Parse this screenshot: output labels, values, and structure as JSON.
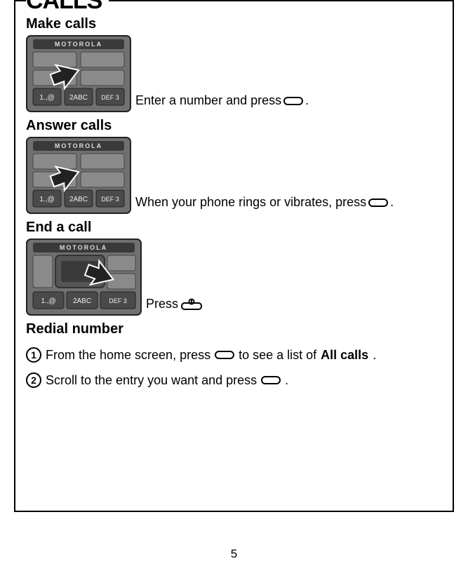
{
  "page_title": "CALLS",
  "sections": {
    "make": {
      "title": "Make calls",
      "text_a": "Enter a number and press",
      "text_b": "."
    },
    "answer": {
      "title": "Answer calls",
      "text_a": "When your phone rings or vibrates, press",
      "text_b": "."
    },
    "end": {
      "title": "End a call",
      "text_a": "Press"
    },
    "redial": {
      "title": "Redial number",
      "step1_a": "From the home screen, press",
      "step1_b": "to see a list of",
      "step1_bold": "All calls",
      "step1_c": ".",
      "step2_a": "Scroll to the entry you want and press",
      "step2_b": "."
    }
  },
  "page_number": "5"
}
